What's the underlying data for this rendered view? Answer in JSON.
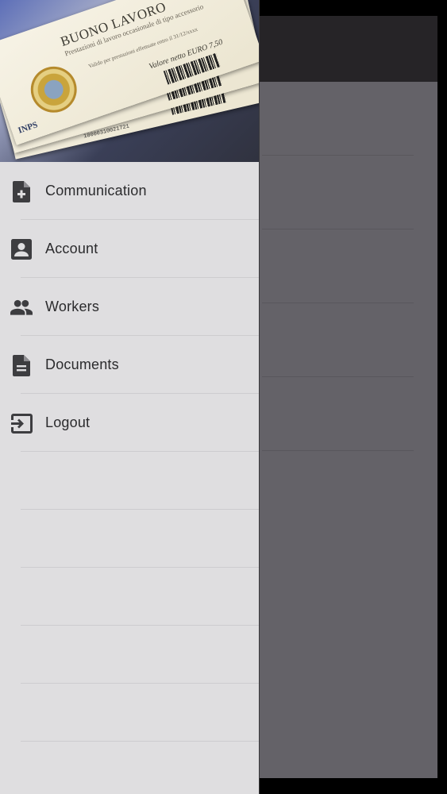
{
  "header": {
    "image": "voucher-image",
    "voucher_title": "BUONO LAVORO",
    "voucher_subtitle": "Prestazioni di lavoro occasionale di tipo accessorio",
    "voucher_value": "Valore netto EURO 7,50",
    "voucher_validity": "Valido per prestazioni effettuate entro il 31/12/xxxx",
    "voucher_issuer": "INPS",
    "voucher_code": "10000310021721"
  },
  "menu": {
    "items": [
      {
        "label": "Communication",
        "icon": "add-document-icon"
      },
      {
        "label": "Account",
        "icon": "account-box-icon"
      },
      {
        "label": "Workers",
        "icon": "people-icon"
      },
      {
        "label": "Documents",
        "icon": "document-icon"
      },
      {
        "label": "Logout",
        "icon": "logout-icon"
      }
    ]
  },
  "colors": {
    "drawer_bg": "#dfdee0",
    "scrim": "#646268",
    "toolbar": "#262427",
    "icon": "#3d3d40",
    "text": "#2b2b2d"
  }
}
